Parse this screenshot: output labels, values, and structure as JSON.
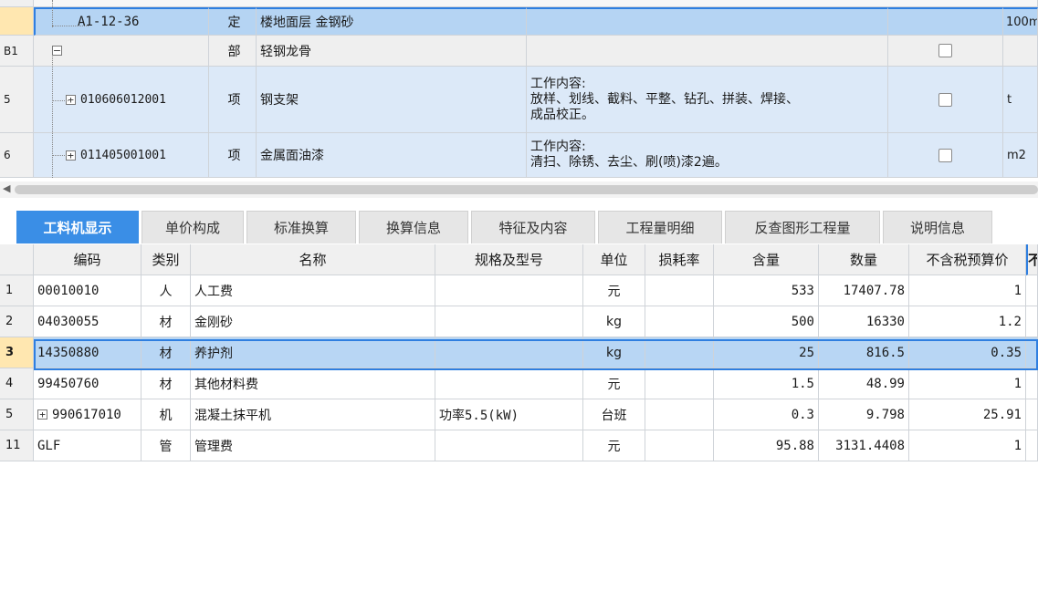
{
  "upper": {
    "rows": [
      {
        "code": "A1-12-36",
        "type": "定",
        "name": "楼地面层 金钢砂",
        "content": "",
        "unit": "100m"
      },
      {
        "rownum": "B1",
        "type": "部",
        "name": "轻钢龙骨"
      },
      {
        "rownum": "5",
        "code": "010606012001",
        "type": "项",
        "name": "钢支架",
        "content_line1": "工作内容:",
        "content_line2": "放样、划线、截料、平整、钻孔、拼装、焊接、",
        "content_line3": "成品校正。",
        "unit": "t"
      },
      {
        "rownum": "6",
        "code": "011405001001",
        "type": "项",
        "name": "金属面油漆",
        "content_line1": "工作内容:",
        "content_line2": "清扫、除锈、去尘、刷(喷)漆2遍。",
        "unit": "m2"
      }
    ]
  },
  "tabs": [
    {
      "label": "工料机显示",
      "active": true
    },
    {
      "label": "单价构成"
    },
    {
      "label": "标准换算"
    },
    {
      "label": "换算信息"
    },
    {
      "label": "特征及内容"
    },
    {
      "label": "工程量明细"
    },
    {
      "label": "反查图形工程量"
    },
    {
      "label": "说明信息"
    }
  ],
  "lower": {
    "headers": [
      "编码",
      "类别",
      "名称",
      "规格及型号",
      "单位",
      "损耗率",
      "含量",
      "数量",
      "不含税预算价",
      "不"
    ],
    "rows": [
      {
        "no": "1",
        "code": "00010010",
        "cat": "人",
        "name": "人工费",
        "spec": "",
        "unit": "元",
        "loss": "",
        "qty": "533",
        "amount": "17407.78",
        "price": "1"
      },
      {
        "no": "2",
        "code": "04030055",
        "cat": "材",
        "name": "金刚砂",
        "spec": "",
        "unit": "kg",
        "loss": "",
        "qty": "500",
        "amount": "16330",
        "price": "1.2"
      },
      {
        "no": "3",
        "code": "14350880",
        "cat": "材",
        "name": "养护剂",
        "spec": "",
        "unit": "kg",
        "loss": "",
        "qty": "25",
        "amount": "816.5",
        "price": "0.35"
      },
      {
        "no": "4",
        "code": "99450760",
        "cat": "材",
        "name": "其他材料费",
        "spec": "",
        "unit": "元",
        "loss": "",
        "qty": "1.5",
        "amount": "48.99",
        "price": "1"
      },
      {
        "no": "5",
        "code": "990617010",
        "cat": "机",
        "name": "混凝土抹平机",
        "spec": "功率5.5(kW)",
        "unit": "台班",
        "loss": "",
        "qty": "0.3",
        "amount": "9.798",
        "price": "25.91"
      },
      {
        "no": "11",
        "code": "GLF",
        "cat": "管",
        "name": "管理费",
        "spec": "",
        "unit": "元",
        "loss": "",
        "qty": "95.88",
        "amount": "3131.4408",
        "price": "1"
      }
    ]
  },
  "colors": {
    "accent": "#3a8ee6",
    "row_blue": "#dce9f8",
    "row_selected": "#b8d6f4"
  }
}
